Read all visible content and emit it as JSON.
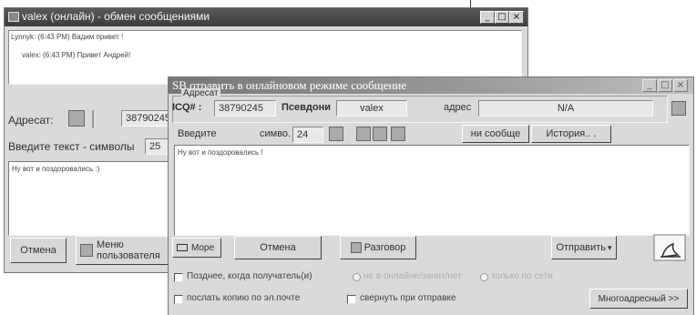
{
  "back_window": {
    "title": "valex (онлайн) - обмен сообщениями",
    "log": [
      "Lynnyk: (6:43 PM) Вадим привет !",
      "valex: (6:43 PM) Привет Андрей!"
    ],
    "addressee_label": "Адресат:",
    "icq_number": "38790245",
    "enter_text_label": "Введите текст - символы",
    "char_count": "25",
    "message_text": "Ну вот и поздоровались :)",
    "cancel_button": "Отмена",
    "user_menu_button": "Меню пользователя"
  },
  "front_window": {
    "title": "SB отравить в онлайновом режиме сообщение",
    "group_title": "Адресат",
    "icq_label": "ICQ# :",
    "icq_number": "38790245",
    "nick_label": "Псевдони",
    "nick_value": "valex",
    "email_label": "адрес",
    "email_value": "N/A",
    "enter_label": "Введите",
    "chars_label": "симво.",
    "char_count": "24",
    "send_messages_tab": "ни сообще",
    "history_button": "История.. .",
    "message_text": "Ну вот и поздоровались !",
    "more_button": "Mope",
    "cancel_button": "Отмена",
    "chat_button": "Разговор",
    "send_button": "Отправить",
    "options": {
      "later_label": "Позднее, когда получатель(и)",
      "radio1_label": "не в онлайне/занят/нет",
      "radio2_label": "только по сети",
      "email_copy_label": "послать копию по эл.почте",
      "collapse_label": "свернуть при отправке",
      "multi_button": "Многоадресный >>"
    }
  }
}
